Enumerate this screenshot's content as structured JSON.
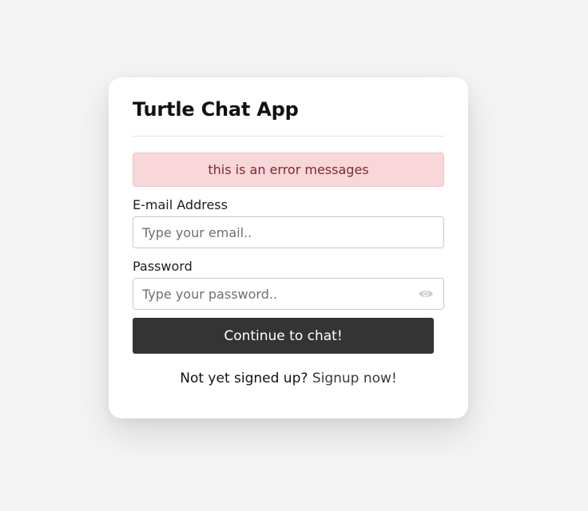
{
  "app": {
    "title": "Turtle Chat App"
  },
  "alert": {
    "message": "this is an error messages"
  },
  "form": {
    "email_label": "E-mail Address",
    "email_placeholder": "Type your email..",
    "password_label": "Password",
    "password_placeholder": "Type your password..",
    "submit_label": "Continue to chat!"
  },
  "signup": {
    "prompt": "Not yet signed up?",
    "link_label": "Signup now!"
  },
  "icons": {
    "password_toggle": "eye-icon"
  },
  "colors": {
    "page_background": "#f4f4f4",
    "card_background": "#ffffff",
    "error_background": "#f8d7da",
    "error_text": "#7a2a31",
    "button_background": "#343434",
    "button_text": "#ffffff"
  }
}
